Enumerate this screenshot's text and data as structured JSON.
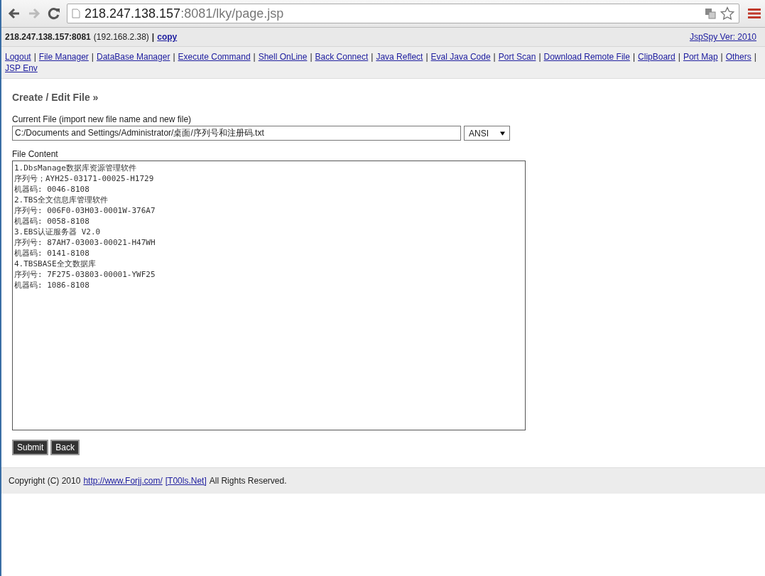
{
  "browser": {
    "address_host": "218.247.138.157",
    "address_rest": ":8081/lky/page.jsp"
  },
  "header": {
    "host": "218.247.138.157:8081",
    "ip": "(192.168.2.38)",
    "separator": "|",
    "copy_link": "copy",
    "version_link": "JspSpy Ver: 2010"
  },
  "nav": [
    {
      "label": "Logout",
      "sep": "|"
    },
    {
      "label": "File Manager",
      "sep": "|"
    },
    {
      "label": "DataBase Manager",
      "sep": "|"
    },
    {
      "label": "Execute Command",
      "sep": "|"
    },
    {
      "label": "Shell OnLine",
      "sep": "|"
    },
    {
      "label": "Back Connect",
      "sep": "|"
    },
    {
      "label": "Java Reflect",
      "sep": "|"
    },
    {
      "label": "Eval Java Code",
      "sep": "|"
    },
    {
      "label": "Port Scan",
      "sep": "|"
    },
    {
      "label": "Download Remote File",
      "sep": "|"
    },
    {
      "label": "ClipBoard",
      "sep": "|"
    },
    {
      "label": "Port Map",
      "sep": "|"
    },
    {
      "label": "Others",
      "sep": "|"
    },
    {
      "label": "JSP Env"
    }
  ],
  "form": {
    "title": "Create / Edit File »",
    "file_label": "Current File (import new file name and new file)",
    "file_value": "C:/Documents and Settings/Administrator/桌面/序列号和注册码.txt",
    "encoding": "ANSI",
    "content_label": "File Content",
    "content_lines": [
      "1.DbsManage数据库资源管理软件",
      "序列号；AYH25-03171-00025-H1729",
      "机器码: 0046-8108",
      "2.TBS全文信息库管理软件",
      "序列号: 006F0-03H03-0001W-376A7",
      "机器码: 0058-8108",
      "3.EBS认证服务器 V2.0",
      "序列号: 87AH7-03003-00021-H47WH",
      "机器码: 0141-8108",
      "4.TBSBASE全文数据库",
      "序列号: 7F275-03803-00001-YWF25",
      "机器码: 1086-8108"
    ],
    "buttons": [
      "Submit",
      "Back"
    ]
  },
  "footer": {
    "copyright": "Copyright (C) 2010",
    "link": "http://www.Forjj.com/",
    "tools_link": "[T00ls.Net]",
    "rights": "All Rights Reserved."
  }
}
